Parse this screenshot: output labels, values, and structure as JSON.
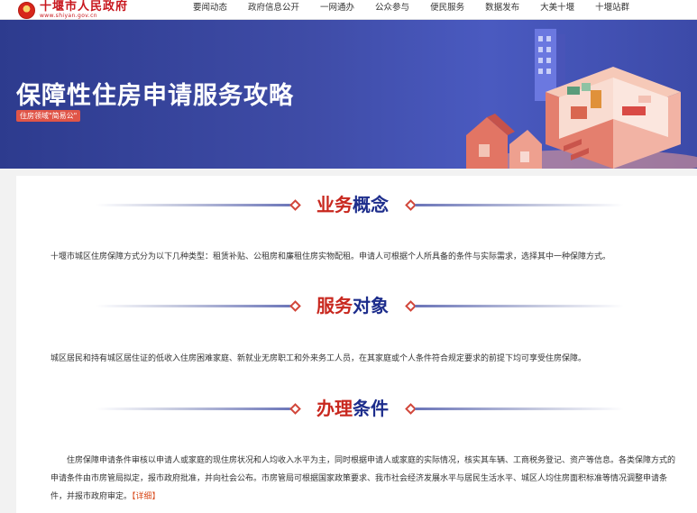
{
  "header": {
    "site_name": "十堰市人民政府",
    "site_url": "www.shiyan.gov.cn",
    "nav": [
      "要闻动态",
      "政府信息公开",
      "一网通办",
      "公众参与",
      "便民服务",
      "数据发布",
      "大美十堰",
      "十堰站群"
    ]
  },
  "banner": {
    "title": "保障性住房申请服务攻略",
    "tag": "住房领域\"简易公\""
  },
  "sections": [
    {
      "title_a": "业务",
      "title_b": "概念",
      "text": "十堰市城区住房保障方式分为以下几种类型：租赁补贴、公租房和廉租住房实物配租。申请人可根据个人所具备的条件与实际需求，选择其中一种保障方式。"
    },
    {
      "title_a": "服务",
      "title_b": "对象",
      "text": "城区居民和持有城区居住证的低收入住房困难家庭、新就业无房职工和外来务工人员，在其家庭或个人条件符合规定要求的前提下均可享受住房保障。"
    },
    {
      "title_a": "办理",
      "title_b": "条件",
      "text": "住房保障申请条件审核以申请人或家庭的现住房状况和人均收入水平为主，同时根据申请人或家庭的实际情况，核实其车辆、工商税务登记、资产等信息。各类保障方式的申请条件由市房管局拟定，报市政府批准，并向社会公布。市房管局可根据国家政策要求、我市社会经济发展水平与居民生活水平、城区人均住房面积标准等情况调整申请条件，并报市政府审定。",
      "detail_link": "【详细】"
    }
  ],
  "colors": {
    "brand_red": "#c8161d",
    "title_blue": "#1d2d8c",
    "banner_blue": "#3f4ca7",
    "detail_orange": "#d84a1b"
  }
}
